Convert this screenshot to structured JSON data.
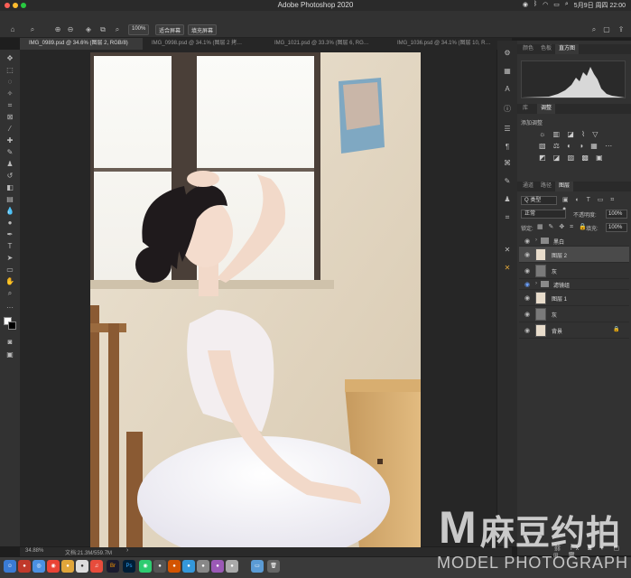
{
  "menubar": {
    "title": "Adobe Photoshop 2020",
    "clock": "5月9日 周四  22:00"
  },
  "options_bar": {
    "zoom_value": "100%",
    "fit_screen": "适合屏幕",
    "fill_screen": "填充屏幕"
  },
  "tabs": [
    {
      "label": "IMG_0989.psd @ 34.6% (图层 2, RGB/8)",
      "active": true
    },
    {
      "label": "IMG_0998.psd @ 34.1% (图层 2 拷…",
      "active": false
    },
    {
      "label": "IMG_1021.psd @ 33.3% (图层 6, RG…",
      "active": false
    },
    {
      "label": "IMG_1036.psd @ 34.1% (图层 10, R…",
      "active": false
    }
  ],
  "statusbar": {
    "zoom": "34.88%",
    "doc": "文档:21.3M/559.7M"
  },
  "panels": {
    "top_tabs": [
      "颜色",
      "色板",
      "直方图"
    ],
    "mid_tabs": [
      "库",
      "调整"
    ],
    "adjust_title": "添加调整",
    "layer_tabs": [
      "通道",
      "路径",
      "图层"
    ],
    "filter_kind": "Q 类型",
    "blend_mode": "正常",
    "opacity_label": "不透明度:",
    "opacity_value": "100%",
    "lock_label": "锁定:",
    "fill_label": "填充:",
    "fill_value": "100%"
  },
  "layers": [
    {
      "name": "黑白",
      "type": "group",
      "selected": false
    },
    {
      "name": "图层 2",
      "type": "photo",
      "selected": true
    },
    {
      "name": "灰",
      "type": "gray",
      "selected": false
    },
    {
      "name": "滤镜组",
      "type": "group",
      "selected": false
    },
    {
      "name": "图层 1",
      "type": "photo",
      "selected": false
    },
    {
      "name": "灰",
      "type": "gray",
      "selected": false
    },
    {
      "name": "背景",
      "type": "photo",
      "selected": false
    }
  ],
  "watermark": {
    "logo": "M",
    "brand": "麻豆约拍",
    "tagline": "MODEL PHOTOGRAPH"
  },
  "colors": {
    "accent": "#2d8ceb",
    "panel": "#323232",
    "canvas_bg": "#262626"
  }
}
